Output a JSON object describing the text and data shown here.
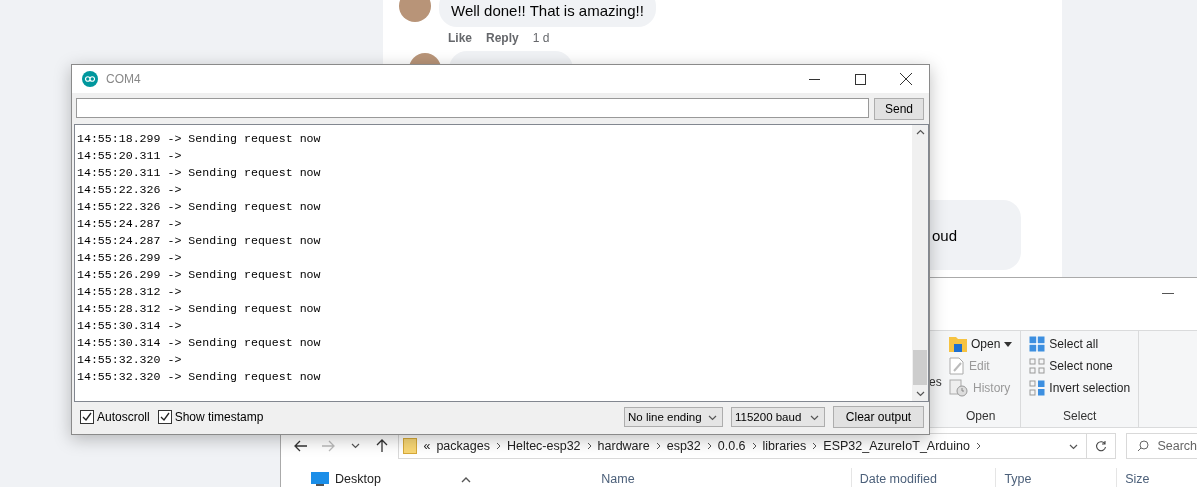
{
  "background_post": {
    "comments": [
      {
        "text": "Well done!! That is amazing!!",
        "actions": [
          "Like",
          "Reply"
        ],
        "time": "1 d"
      }
    ],
    "partial_bubble_text": "oud"
  },
  "serial_monitor": {
    "title": "COM4",
    "send_button": "Send",
    "lines": [
      "14:55:18.299 -> Sending request now",
      "14:55:20.311 ->",
      "14:55:20.311 -> Sending request now",
      "14:55:22.326 ->",
      "14:55:22.326 -> Sending request now",
      "14:55:24.287 ->",
      "14:55:24.287 -> Sending request now",
      "14:55:26.299 ->",
      "14:55:26.299 -> Sending request now",
      "14:55:28.312 ->",
      "14:55:28.312 -> Sending request now",
      "14:55:30.314 ->",
      "14:55:30.314 -> Sending request now",
      "14:55:32.320 ->",
      "14:55:32.320 -> Sending request now"
    ],
    "options": [
      {
        "label": "Autoscroll",
        "checked": true
      },
      {
        "label": "Show timestamp",
        "checked": true
      }
    ],
    "line_ending": "No line ending",
    "baud": "115200 baud",
    "clear_button": "Clear output"
  },
  "file_explorer": {
    "ribbon": {
      "partial_label": "es",
      "groups": [
        {
          "label": "Open",
          "items": [
            {
              "label": "Open",
              "kind": "folder",
              "dropdown": true,
              "disabled": false
            },
            {
              "label": "Edit",
              "kind": "document",
              "dropdown": false,
              "disabled": true
            },
            {
              "label": "History",
              "kind": "history",
              "dropdown": false,
              "disabled": true
            }
          ]
        },
        {
          "label": "Select",
          "items": [
            {
              "label": "Select all",
              "kind": "select-all",
              "dropdown": false,
              "disabled": false
            },
            {
              "label": "Select none",
              "kind": "select-none",
              "dropdown": false,
              "disabled": false
            },
            {
              "label": "Invert selection",
              "kind": "invert",
              "dropdown": false,
              "disabled": false
            }
          ]
        }
      ]
    },
    "address": {
      "overflow": "«",
      "crumbs": [
        "packages",
        "Heltec-esp32",
        "hardware",
        "esp32",
        "0.0.6",
        "libraries",
        "ESP32_AzureIoT_Arduino"
      ]
    },
    "search": {
      "placeholder": "Search"
    },
    "nav": [
      "Desktop"
    ],
    "columns": [
      "Name",
      "Date modified",
      "Type",
      "Size"
    ]
  }
}
